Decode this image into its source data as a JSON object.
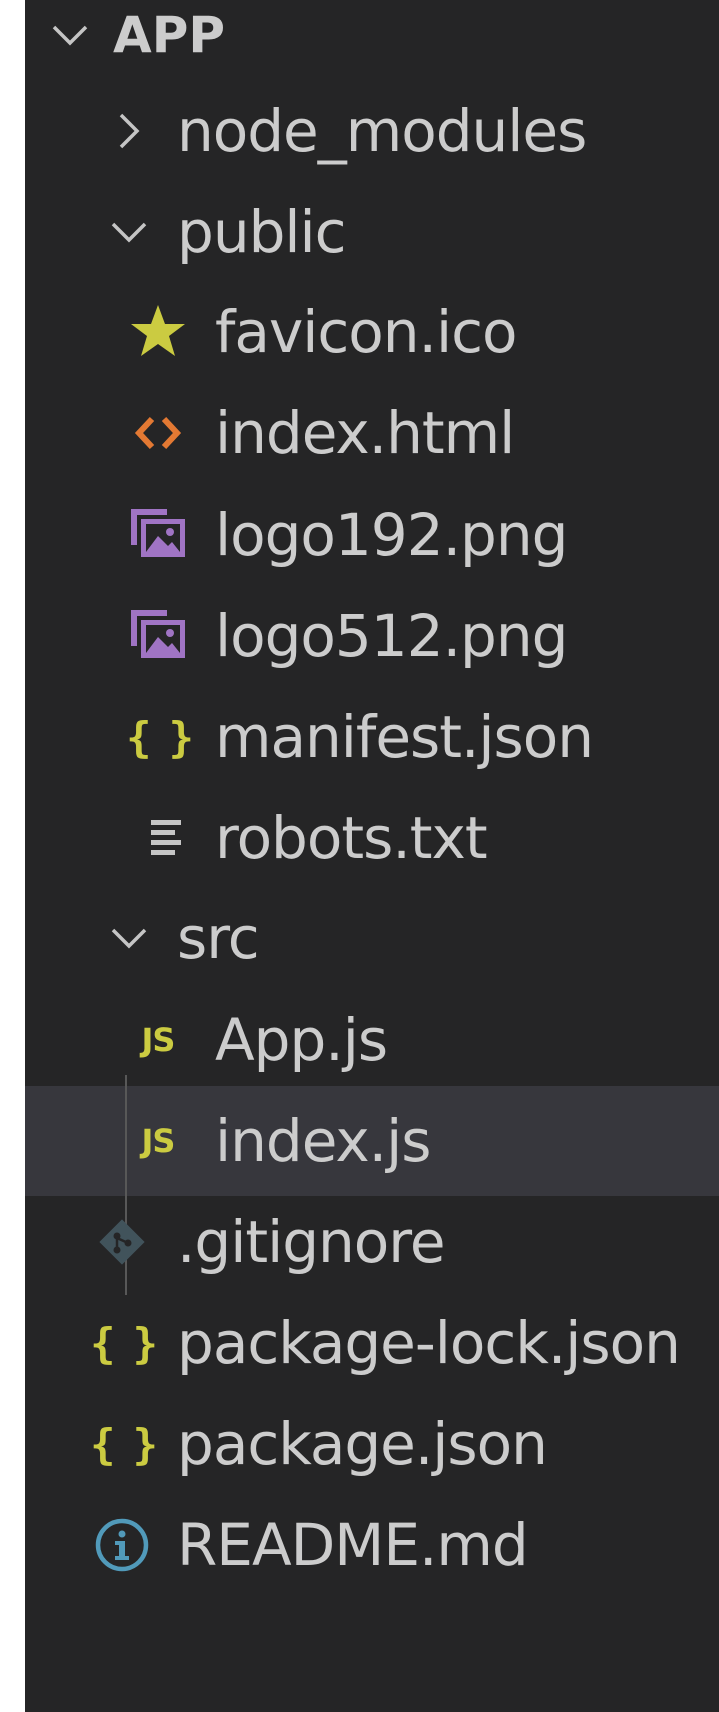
{
  "explorer": {
    "root": {
      "label": "APP",
      "expanded": true
    },
    "items": [
      {
        "label": "node_modules",
        "type": "folder",
        "expanded": false
      },
      {
        "label": "public",
        "type": "folder",
        "expanded": true
      },
      {
        "label": "favicon.ico",
        "type": "file",
        "icon": "star-icon"
      },
      {
        "label": "index.html",
        "type": "file",
        "icon": "html-icon"
      },
      {
        "label": "logo192.png",
        "type": "file",
        "icon": "image-icon"
      },
      {
        "label": "logo512.png",
        "type": "file",
        "icon": "image-icon"
      },
      {
        "label": "manifest.json",
        "type": "file",
        "icon": "json-icon"
      },
      {
        "label": "robots.txt",
        "type": "file",
        "icon": "text-file-icon"
      },
      {
        "label": "src",
        "type": "folder",
        "expanded": true
      },
      {
        "label": "App.js",
        "type": "file",
        "icon": "javascript-icon"
      },
      {
        "label": "index.js",
        "type": "file",
        "icon": "javascript-icon",
        "selected": true
      },
      {
        "label": ".gitignore",
        "type": "file",
        "icon": "git-icon"
      },
      {
        "label": "package-lock.json",
        "type": "file",
        "icon": "json-icon"
      },
      {
        "label": "package.json",
        "type": "file",
        "icon": "json-icon"
      },
      {
        "label": "README.md",
        "type": "file",
        "icon": "info-icon"
      }
    ]
  },
  "icons": {
    "js_text": "JS"
  },
  "colors": {
    "background": "#252526",
    "selected_row": "#37373d",
    "text": "#cccccc",
    "js_yellow": "#cbcb41",
    "html_orange": "#e37933",
    "image_purple": "#a074c4",
    "git_blue": "#41535b",
    "info_blue": "#519aba"
  }
}
